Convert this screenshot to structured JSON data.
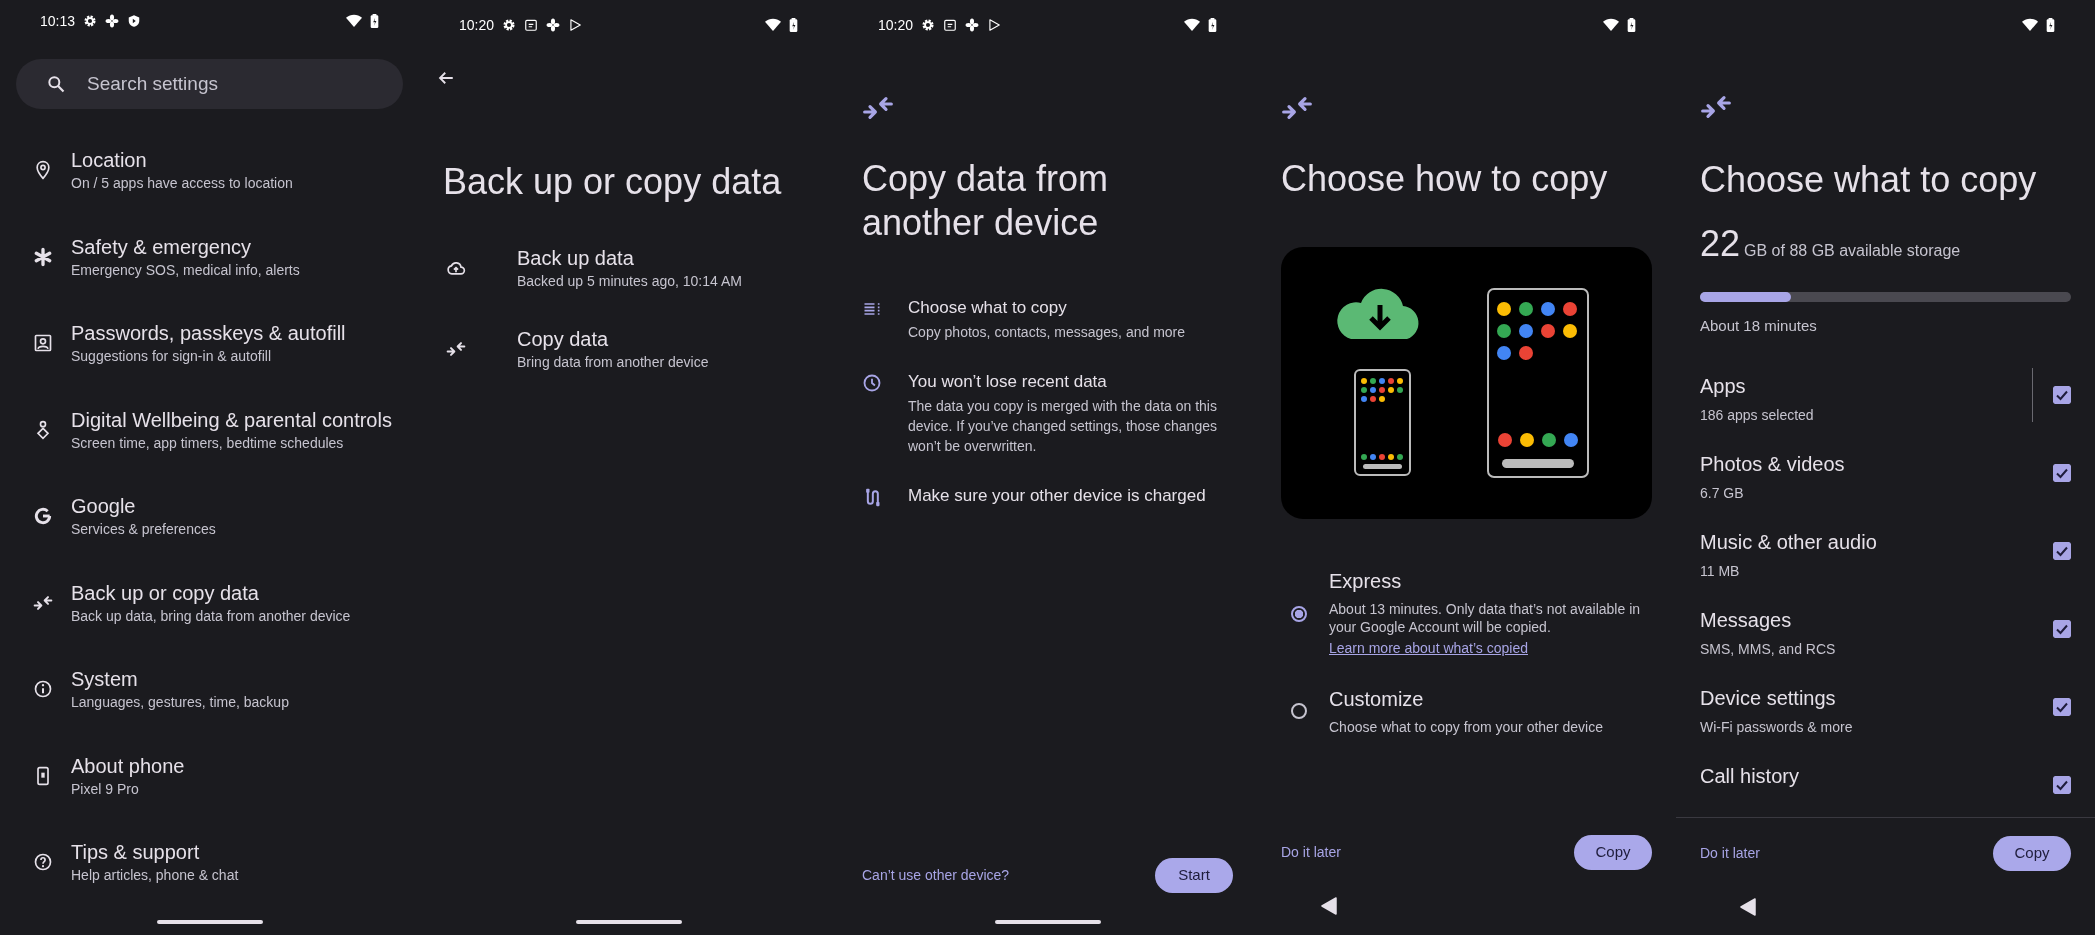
{
  "screens": [
    {
      "kind": "settings",
      "status_bar": {
        "time": "10:13"
      },
      "search": {
        "placeholder": "Search settings"
      },
      "items": [
        {
          "title": "Location",
          "subtitle": "On / 5 apps have access to location"
        },
        {
          "title": "Safety & emergency",
          "subtitle": "Emergency SOS, medical info, alerts"
        },
        {
          "title": "Passwords, passkeys & autofill",
          "subtitle": "Suggestions for sign-in & autofill"
        },
        {
          "title": "Digital Wellbeing & parental controls",
          "subtitle": "Screen time, app timers, bedtime schedules"
        },
        {
          "title": "Google",
          "subtitle": "Services & preferences"
        },
        {
          "title": "Back up or copy data",
          "subtitle": "Back up data, bring data from another device"
        },
        {
          "title": "System",
          "subtitle": "Languages, gestures, time, backup"
        },
        {
          "title": "About phone",
          "subtitle": "Pixel 9 Pro"
        },
        {
          "title": "Tips & support",
          "subtitle": "Help articles, phone & chat"
        }
      ]
    },
    {
      "kind": "backup",
      "status_bar": {
        "time": "10:20"
      },
      "title": "Back up or copy data",
      "items": [
        {
          "title": "Back up data",
          "subtitle": "Backed up 5 minutes ago, 10:14 AM"
        },
        {
          "title": "Copy data",
          "subtitle": "Bring data from another device"
        }
      ]
    },
    {
      "kind": "intro",
      "status_bar": {
        "time": "10:20"
      },
      "title": "Copy data from another device",
      "items": [
        {
          "title": "Choose what to copy",
          "subtitle": "Copy photos, contacts, messages, and more"
        },
        {
          "title": "You won’t lose recent data",
          "subtitle": "The data you copy is merged with the data on this device. If you’ve changed settings, those changes won’t be overwritten."
        },
        {
          "title": "Make sure your other device is charged"
        }
      ],
      "secondary": "Can’t use other device?",
      "primary": "Start"
    },
    {
      "kind": "method",
      "title": "Choose how to copy",
      "options": [
        {
          "title": "Express",
          "description": "About 13 minutes. Only data that’s not available in your Google Account will be copied.",
          "link": "Learn more about what’s copied",
          "selected": true
        },
        {
          "title": "Customize",
          "description": "Choose what to copy from your other device",
          "selected": false
        }
      ],
      "secondary": "Do it later",
      "primary": "Copy"
    },
    {
      "kind": "select",
      "title": "Choose what to copy",
      "storage": {
        "amount": "22",
        "caption": "GB of 88 GB available storage",
        "level": 0.245
      },
      "estimate": "About 18 minutes",
      "items": [
        {
          "title": "Apps",
          "subtitle": "186 apps selected",
          "checked": true
        },
        {
          "title": "Photos & videos",
          "subtitle": "6.7 GB",
          "checked": true
        },
        {
          "title": "Music & other audio",
          "subtitle": "11 MB",
          "checked": true
        },
        {
          "title": "Messages",
          "subtitle": "SMS, MMS, and RCS",
          "checked": true
        },
        {
          "title": "Device settings",
          "subtitle": "Wi-Fi passwords & more",
          "checked": true
        },
        {
          "title": "Call history",
          "checked": true
        }
      ],
      "secondary": "Do it later",
      "primary": "Copy"
    }
  ]
}
